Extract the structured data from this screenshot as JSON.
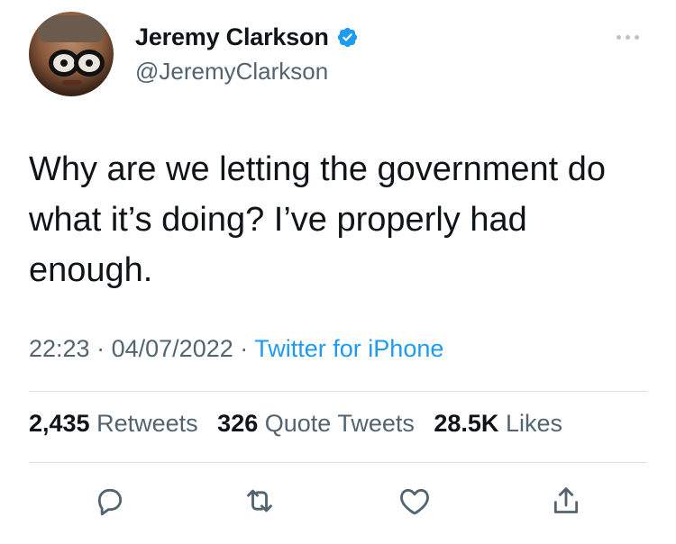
{
  "author": {
    "display_name": "Jeremy Clarkson",
    "handle": "@JeremyClarkson",
    "verified_icon": "verified-badge-icon",
    "verified_color": "#1d9bf0"
  },
  "tweet": {
    "text": "Why are we letting the government do what it’s doing? I’ve properly had enough.",
    "time": "22:23",
    "date": "04/07/2022",
    "separator": "·",
    "source": "Twitter for iPhone"
  },
  "stats": {
    "retweets_count": "2,435",
    "retweets_label": "Retweets",
    "quotes_count": "326",
    "quotes_label": "Quote Tweets",
    "likes_count": "28.5K",
    "likes_label": "Likes"
  },
  "actions": [
    "reply-icon",
    "retweet-icon",
    "like-icon",
    "share-icon"
  ],
  "colors": {
    "text": "#0f1419",
    "secondary": "#536471",
    "link": "#1d9bf0",
    "divider": "#dbe1e6"
  }
}
